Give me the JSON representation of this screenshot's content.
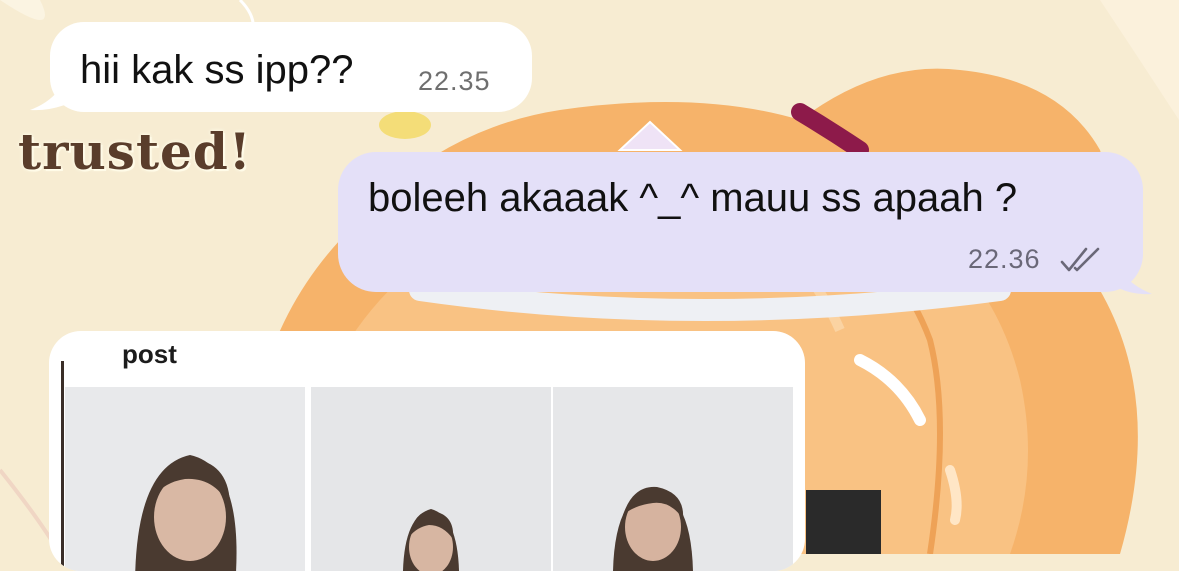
{
  "messages": [
    {
      "direction": "incoming",
      "text": "hii kak ss ipp??",
      "time": "22.35"
    },
    {
      "direction": "outgoing",
      "text": "boleeh akaaak ^_^ mauu ss apaah ?",
      "time": "22.36",
      "status_icon": "double-check-icon"
    }
  ],
  "sticker": {
    "text": "trusted!"
  },
  "image_message": {
    "caption_label": "post",
    "photo_count": 3
  },
  "colors": {
    "incoming_bubble": "#ffffff",
    "outgoing_bubble": "#e4e0f8",
    "wallpaper": "#f7ecd2",
    "hair_accent": "#f5b46a"
  }
}
